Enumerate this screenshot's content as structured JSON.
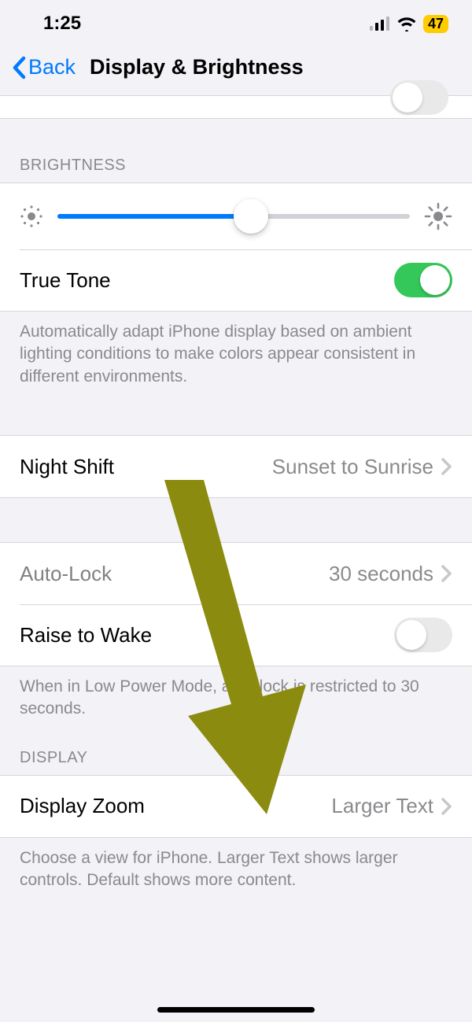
{
  "status": {
    "time": "1:25",
    "battery": "47"
  },
  "nav": {
    "back": "Back",
    "title": "Display & Brightness"
  },
  "sections": {
    "brightness": {
      "header": "BRIGHTNESS",
      "slider_percent": 55,
      "trueTone": {
        "label": "True Tone",
        "on": true
      },
      "footer": "Automatically adapt iPhone display based on ambient lighting conditions to make colors appear consistent in different environments."
    },
    "nightShift": {
      "label": "Night Shift",
      "value": "Sunset to Sunrise"
    },
    "autoLock": {
      "label": "Auto-Lock",
      "value": "30 seconds"
    },
    "raiseToWake": {
      "label": "Raise to Wake",
      "on": false
    },
    "autoLockFooter": "When in Low Power Mode, auto-lock is restricted to 30 seconds.",
    "display": {
      "header": "DISPLAY",
      "zoom": {
        "label": "Display Zoom",
        "value": "Larger Text"
      },
      "footer": "Choose a view for iPhone. Larger Text shows larger controls. Default shows more content."
    }
  }
}
